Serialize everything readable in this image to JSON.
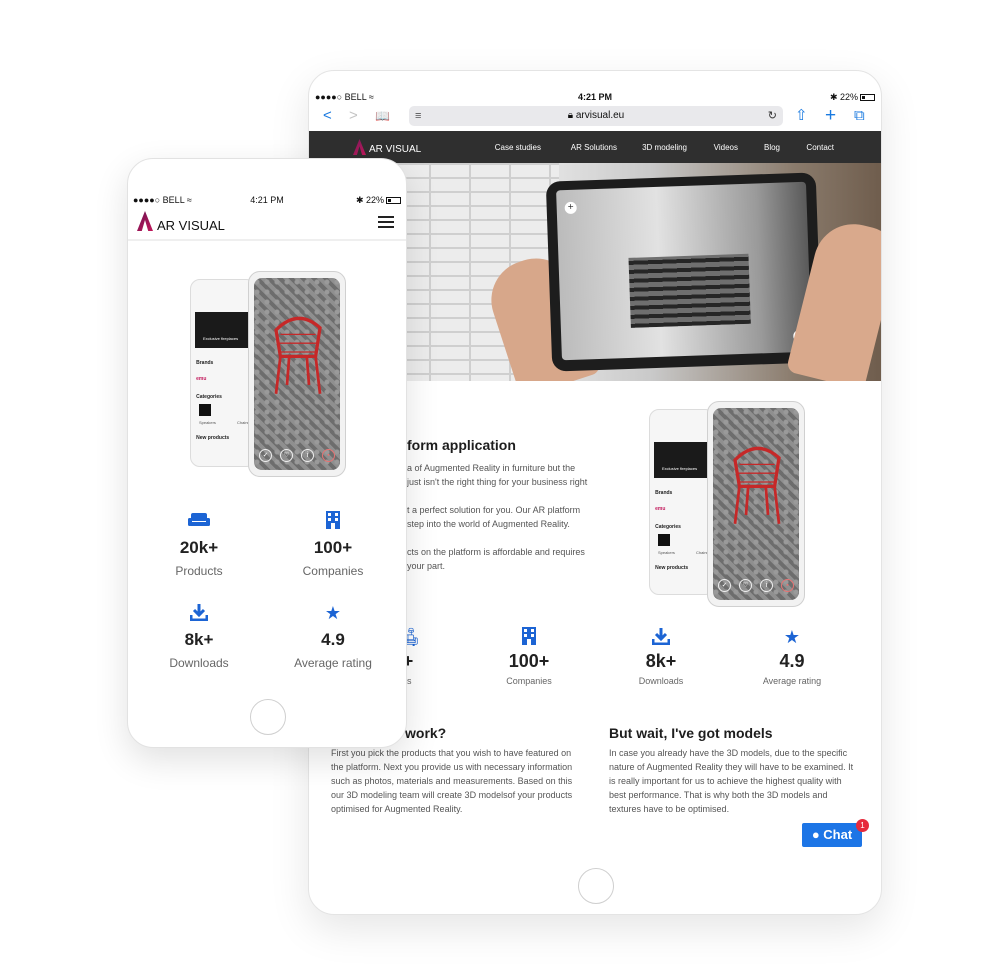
{
  "tablet": {
    "status": {
      "carrier": "●●●●○ BELL ≈",
      "time": "4:21 PM",
      "battery": "✱ 22%"
    },
    "toolbar": {
      "back": "<",
      "forward": ">",
      "bookmarks": "📖",
      "url": "arvisual.eu",
      "reader": "≡",
      "reload": "↻",
      "share": "⇧",
      "add": "+",
      "tabs": "⧉"
    },
    "nav": {
      "logo_text": "AR VISUAL",
      "items": [
        "Case studies",
        "AR Solutions",
        "3D modeling",
        "Videos",
        "Blog",
        "Contact"
      ]
    },
    "section1": {
      "heading": "form application",
      "para1": [
        "a of Augmented Reality in furniture but the",
        "just isn't the right thing for your business right"
      ],
      "para2": [
        "t a perfect solution for you. Our AR platform",
        "step into the world of Augmented Reality."
      ],
      "para3": [
        "cts on the platform is affordable and requires",
        "your part."
      ]
    },
    "mockup": {
      "back_title": "Exclusive fireplaces",
      "brands": "Brands",
      "brand_logo": "emu",
      "categories": "Categories",
      "cat1": "Speakers",
      "cat2": "Chairs",
      "new_products": "New products"
    },
    "stats": [
      {
        "icon": "sofa-icon",
        "value": "+",
        "label": "ts"
      },
      {
        "icon": "building-icon",
        "value": "100+",
        "label": "Companies"
      },
      {
        "icon": "download-icon",
        "value": "8k+",
        "label": "Downloads"
      },
      {
        "icon": "star-icon",
        "value": "4.9",
        "label": "Average rating"
      }
    ],
    "how": {
      "heading": "work?",
      "lines": [
        "First you pick the products that you wish to have featured on",
        "the platform. Next you provide us with necessary information",
        "such as photos, materials and measurements. Based on this",
        "our 3D modeling team will create 3D modelsof your products",
        "optimised for Augmented Reality."
      ]
    },
    "models": {
      "heading": "But wait, I've got models",
      "lines": [
        "In case you already have the 3D models, due to the specific",
        "nature of Augmented Reality they will have to be examined. It",
        "is really important for us to achieve the highest quality with",
        "best performance. That is why both the 3D models and",
        "textures have to be optimised."
      ]
    },
    "chat": {
      "label": "Chat",
      "badge": "1"
    }
  },
  "phone": {
    "status": {
      "carrier": "●●●●○ BELL ≈",
      "time": "4:21 PM",
      "battery": "✱ 22%"
    },
    "logo_text": "AR VISUAL",
    "stats": [
      {
        "icon": "sofa-icon",
        "value": "20k+",
        "label": "Products"
      },
      {
        "icon": "building-icon",
        "value": "100+",
        "label": "Companies"
      },
      {
        "icon": "download-icon",
        "value": "8k+",
        "label": "Downloads"
      },
      {
        "icon": "star-icon",
        "value": "4.9",
        "label": "Average rating"
      }
    ]
  },
  "colors": {
    "accent_blue": "#1c64d4",
    "nav_bg": "#2f2f2f",
    "chat_blue": "#1d75e6",
    "badge_red": "#e62a3c",
    "brand_magenta": "#c2185b"
  }
}
